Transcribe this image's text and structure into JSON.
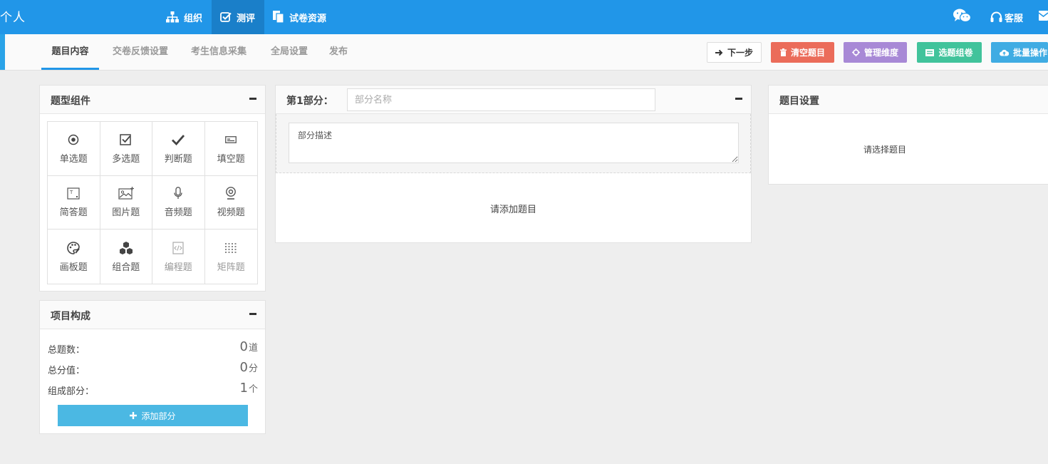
{
  "topbar": {
    "brand": "个人",
    "nav": [
      {
        "label": "组织",
        "icon": "sitemap-icon"
      },
      {
        "label": "测评",
        "icon": "check-square-icon"
      },
      {
        "label": "试卷资源",
        "icon": "copy-icon"
      }
    ],
    "right": [
      {
        "label": "",
        "icon": "wechat-icon"
      },
      {
        "label": "客服",
        "icon": "headset-icon"
      },
      {
        "label": "",
        "icon": "mail-icon"
      }
    ],
    "colors": {
      "bar": "#2196e8",
      "active": "#1a7fc9"
    }
  },
  "subbar": {
    "tabs": [
      "题目内容",
      "交卷反馈设置",
      "考生信息采集",
      "全局设置",
      "发布"
    ],
    "active_tab": "题目内容",
    "buttons": [
      {
        "label": "下一步",
        "icon": "arrow-right-icon",
        "color": "#ffffff"
      },
      {
        "label": "清空题目",
        "icon": "trash-icon",
        "color": "#eb6c5a"
      },
      {
        "label": "管理维度",
        "icon": "crosshair-icon",
        "color": "#a889d6"
      },
      {
        "label": "选题组卷",
        "icon": "list-icon",
        "color": "#41c39b"
      },
      {
        "label": "批量操作",
        "icon": "cloud-upload-icon",
        "color": "#40ace3"
      }
    ]
  },
  "components_panel": {
    "title": "题型组件",
    "items": [
      {
        "label": "单选题",
        "icon": "radio-icon",
        "enabled": true
      },
      {
        "label": "多选题",
        "icon": "checkbox-icon",
        "enabled": true
      },
      {
        "label": "判断题",
        "icon": "checkmark-icon",
        "enabled": true
      },
      {
        "label": "填空题",
        "icon": "fill-blank-icon",
        "enabled": true
      },
      {
        "label": "简答题",
        "icon": "text-box-icon",
        "enabled": true
      },
      {
        "label": "图片题",
        "icon": "image-icon",
        "enabled": true
      },
      {
        "label": "音频题",
        "icon": "microphone-icon",
        "enabled": true
      },
      {
        "label": "视频题",
        "icon": "webcam-icon",
        "enabled": true
      },
      {
        "label": "画板题",
        "icon": "palette-icon",
        "enabled": true
      },
      {
        "label": "组合题",
        "icon": "cubes-icon",
        "enabled": true
      },
      {
        "label": "编程题",
        "icon": "code-file-icon",
        "enabled": false
      },
      {
        "label": "矩阵题",
        "icon": "matrix-icon",
        "enabled": false
      }
    ]
  },
  "composition_panel": {
    "title": "项目构成",
    "stats": [
      {
        "label": "总题数：",
        "value": "0",
        "unit": "道"
      },
      {
        "label": "总分值：",
        "value": "0",
        "unit": "分"
      },
      {
        "label": "组成部分：",
        "value": "1",
        "unit": "个"
      }
    ],
    "add_button": "添加部分"
  },
  "part_panel": {
    "part_label": "第1部分：",
    "name_placeholder": "部分名称",
    "desc_placeholder": "部分描述",
    "empty_text": "请添加题目"
  },
  "settings_panel": {
    "title": "题目设置",
    "empty_text": "请选择题目"
  }
}
